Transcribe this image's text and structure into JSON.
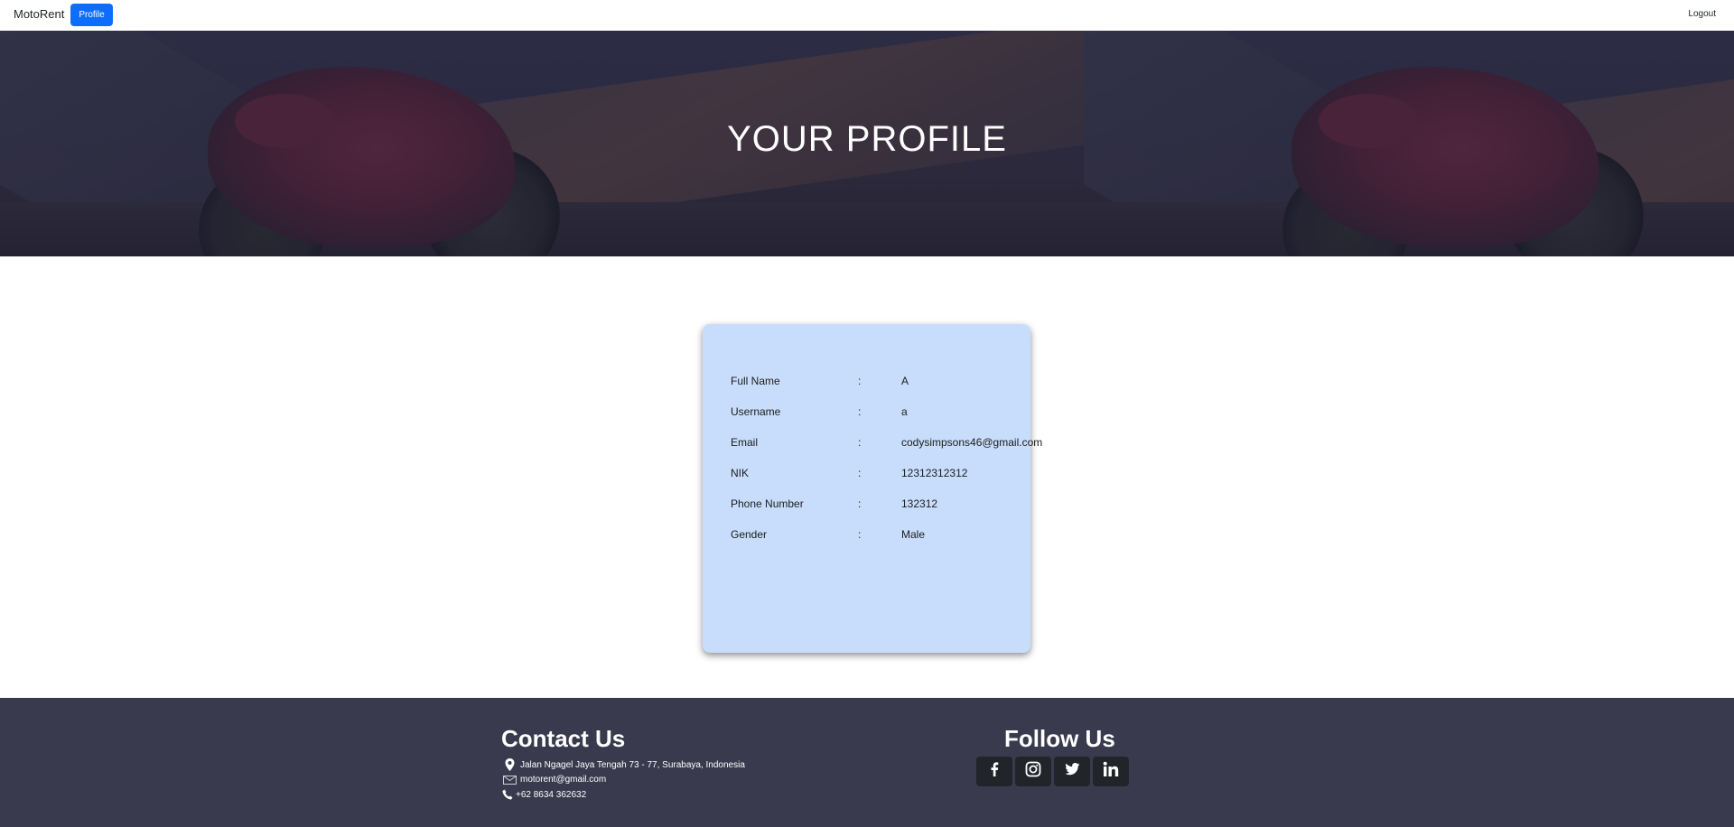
{
  "navbar": {
    "brand": "MotoRent",
    "profile_label": "Profile",
    "logout_label": "Logout",
    "accent_color": "#0d6efd"
  },
  "hero": {
    "title": "YOUR PROFILE"
  },
  "profile": {
    "rows": [
      {
        "label": "Full Name",
        "separator": ":",
        "value": "A"
      },
      {
        "label": "Username",
        "separator": ":",
        "value": "a"
      },
      {
        "label": "Email",
        "separator": ":",
        "value": "codysimpsons46@gmail.com"
      },
      {
        "label": "NIK",
        "separator": ":",
        "value": "12312312312"
      },
      {
        "label": "Phone Number",
        "separator": ":",
        "value": "132312"
      },
      {
        "label": "Gender",
        "separator": ":",
        "value": "Male"
      }
    ],
    "card_color": "#c8ddfc"
  },
  "footer": {
    "contact_title": "Contact Us",
    "address": "Jalan Ngagel Jaya Tengah 73 - 77, Surabaya, Indonesia",
    "email": "motorent@gmail.com",
    "phone": "+62 8634 362632",
    "follow_title": "Follow Us",
    "social": [
      "facebook-icon",
      "instagram-icon",
      "twitter-icon",
      "linkedin-icon"
    ],
    "background_color": "#3a3a4e"
  }
}
